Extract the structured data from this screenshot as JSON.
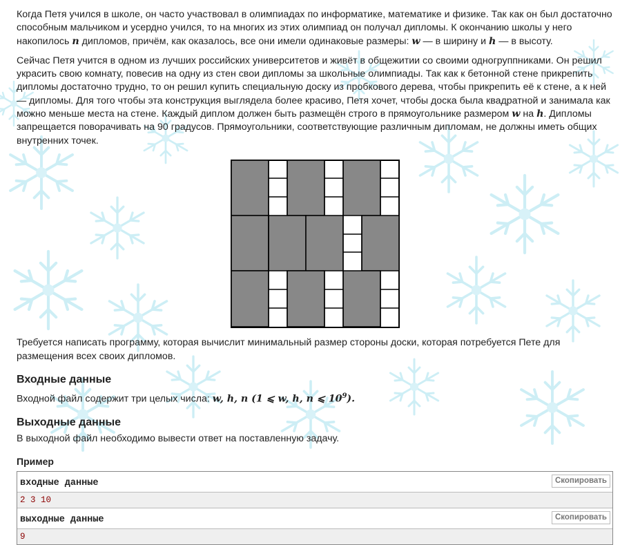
{
  "statement": {
    "p1_a": "Когда Петя учился в школе, он часто участвовал в олимпиадах по информатике, математике и физике. Так как он был достаточно способным мальчиком и усердно учился, то на многих из этих олимпиад он получал дипломы. К окончанию школы у него накопилось ",
    "p1_n": "n",
    "p1_b": " дипломов, причём, как оказалось, все они имели одинаковые размеры: ",
    "p1_w": "w",
    "p1_c": " — в ширину и ",
    "p1_h": "h",
    "p1_d": " — в высоту.",
    "p2_a": "Сейчас Петя учится в одном из лучших российских университетов и живёт в общежитии со своими одногруппниками. Он решил украсить свою комнату, повесив на одну из стен свои дипломы за школьные олимпиады. Так как к бетонной стене прикрепить дипломы достаточно трудно, то он решил купить специальную доску из пробкового дерева, чтобы прикрепить её к стене, а к ней — дипломы. Для того чтобы эта конструкция выглядела более красиво, Петя хочет, чтобы доска была квадратной и занимала как можно меньше места на стене. Каждый диплом должен быть размещён строго в прямоугольнике размером ",
    "p2_w": "w",
    "p2_x": " на ",
    "p2_h": "h",
    "p2_b": ". Дипломы запрещается поворачивать на 90 градусов. Прямоугольники, соответствующие различным дипломам, не должны иметь общих внутренних точек.",
    "p3": "Требуется написать программу, которая вычислит минимальный размер стороны доски, которая потребуется Пете для размещения всех своих дипломов."
  },
  "input_section": {
    "title": "Входные данные",
    "text_a": "Входной файл содержит три целых числа: ",
    "math": "w, h, n (1 ⩽ w, h, n ⩽ 10",
    "sup": "9",
    "text_b": ")."
  },
  "output_section": {
    "title": "Выходные данные",
    "text": "В выходной файл необходимо вывести ответ на поставленную задачу."
  },
  "example": {
    "title": "Пример",
    "input_label": "входные данные",
    "input_value": "2 3 10",
    "output_label": "выходные данные",
    "output_value": "9",
    "copy_label": "Скопировать"
  },
  "colors": {
    "diploma_fill": "#888888",
    "board_border": "#000000",
    "snowflake": "#cdeef5"
  }
}
